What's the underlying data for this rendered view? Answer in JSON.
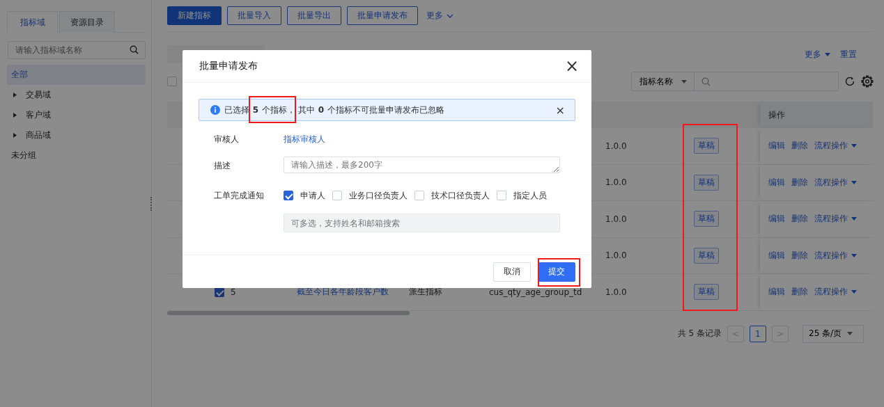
{
  "sidebar": {
    "tabs": [
      {
        "label": "指标域",
        "selected": true
      },
      {
        "label": "资源目录",
        "selected": false
      }
    ],
    "search": {
      "placeholder": "请输入指标域名称"
    },
    "tree": [
      {
        "label": "全部",
        "selected": true,
        "kind": "plain"
      },
      {
        "label": "交易域",
        "selected": false,
        "kind": "group",
        "expanded": false
      },
      {
        "label": "客户域",
        "selected": false,
        "kind": "group",
        "expanded": false
      },
      {
        "label": "商品域",
        "selected": false,
        "kind": "group",
        "expanded": false
      },
      {
        "label": "未分组",
        "selected": false,
        "kind": "plain"
      }
    ]
  },
  "toolbar": {
    "buttons": [
      {
        "label": "新建指标",
        "kind": "primary"
      },
      {
        "label": "批量导入",
        "kind": "outline"
      },
      {
        "label": "批量导出",
        "kind": "outline"
      },
      {
        "label": "批量申请发布",
        "kind": "outline"
      },
      {
        "label": "更多",
        "kind": "link"
      }
    ]
  },
  "filters": {
    "more": "更多",
    "reset": "重置",
    "search_type": "指标名称",
    "select_all": false
  },
  "table": {
    "action_header": "操作",
    "rows": [
      {
        "version": "1.0.0",
        "status": "草稿",
        "actions": [
          "编辑",
          "删除",
          "流程操作"
        ]
      },
      {
        "version": "1.0.0",
        "status": "草稿",
        "actions": [
          "编辑",
          "删除",
          "流程操作"
        ]
      },
      {
        "version": "1.0.0",
        "status": "草稿",
        "actions": [
          "编辑",
          "删除",
          "流程操作"
        ]
      },
      {
        "version": "1.0.0",
        "status": "草稿",
        "actions": [
          "编辑",
          "删除",
          "流程操作"
        ]
      },
      {
        "checked": true,
        "index": "5",
        "name": "截至今日各年龄段客户数",
        "type": "派生指标",
        "code": "cus_qty_age_group_td",
        "version": "1.0.0",
        "status": "草稿",
        "actions": [
          "编辑",
          "删除",
          "流程操作"
        ]
      }
    ]
  },
  "pagination": {
    "total": "共 5 条记录",
    "prev": "<",
    "pages": [
      {
        "label": "1",
        "selected": true
      }
    ],
    "next": ">",
    "page_size": "25 条/页"
  },
  "dialog": {
    "title": "批量申请发布",
    "close": "×",
    "alert": "已选择 **5** 个指标， 其中 **0** 个指标不可批量申请发布已忽略",
    "alert_close": "×",
    "reviewer": {
      "label": "审核人",
      "value": "指标审核人"
    },
    "description": {
      "label": "描述",
      "placeholder": "请输入描述，最多200字"
    },
    "notify": {
      "label": "工单完成通知",
      "options": [
        {
          "label": "申请人",
          "checked": true
        },
        {
          "label": "业务口径负责人",
          "checked": false
        },
        {
          "label": "技术口径负责人",
          "checked": false
        },
        {
          "label": "指定人员",
          "checked": false
        }
      ],
      "people_placeholder": "可多选，支持姓名和邮箱搜索"
    },
    "buttons": [
      {
        "label": "取消",
        "kind": "default"
      },
      {
        "label": "提交",
        "kind": "primary"
      }
    ]
  }
}
